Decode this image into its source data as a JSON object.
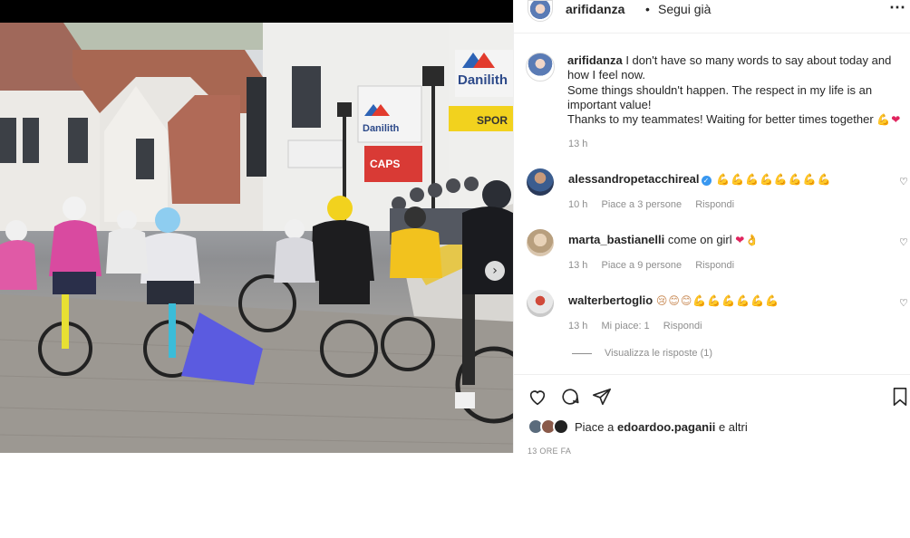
{
  "post": {
    "username": "arifidanza",
    "header_dot": "•",
    "follow_label": "Segui già",
    "more_icon": "more-horizontal-icon",
    "caption_lines": [
      "I don't have so many words to say about today and how I feel now.",
      "Some things shouldn't happen. The respect in my life is an important value!",
      "Thanks to my teammates! Waiting for better times together"
    ],
    "caption_emojis": "💪❤",
    "caption_time": "13 h"
  },
  "photo": {
    "sign_1": "Danilith",
    "sign_2": "Danilith",
    "sign_3": "SPOR",
    "sign_4": "CAPS",
    "next_icon": "›"
  },
  "comments": [
    {
      "username": "alessandropetacchireal",
      "verified": true,
      "text": "💪💪💪💪💪💪💪💪",
      "time": "10 h",
      "likes": "Piace a 3 persone",
      "reply": "Rispondi"
    },
    {
      "username": "marta_bastianelli",
      "verified": false,
      "text": "come on girl",
      "emoji": "❤👌",
      "time": "13 h",
      "likes": "Piace a 9 persone",
      "reply": "Rispondi"
    },
    {
      "username": "walterbertoglio",
      "verified": false,
      "text": "😢😊😊💪💪💪💪💪💪",
      "time": "13 h",
      "likes": "Mi piace: 1",
      "reply": "Rispondi"
    }
  ],
  "view_replies": "Visualizza le risposte (1)",
  "likes": {
    "prefix": "Piace a",
    "user": "edoardoo.paganii",
    "suffix": "e altri"
  },
  "date": "13 ORE FA",
  "colors": {
    "border": "#efefef",
    "muted": "#8e8e8e",
    "text": "#262626",
    "verified": "#3897f0"
  }
}
